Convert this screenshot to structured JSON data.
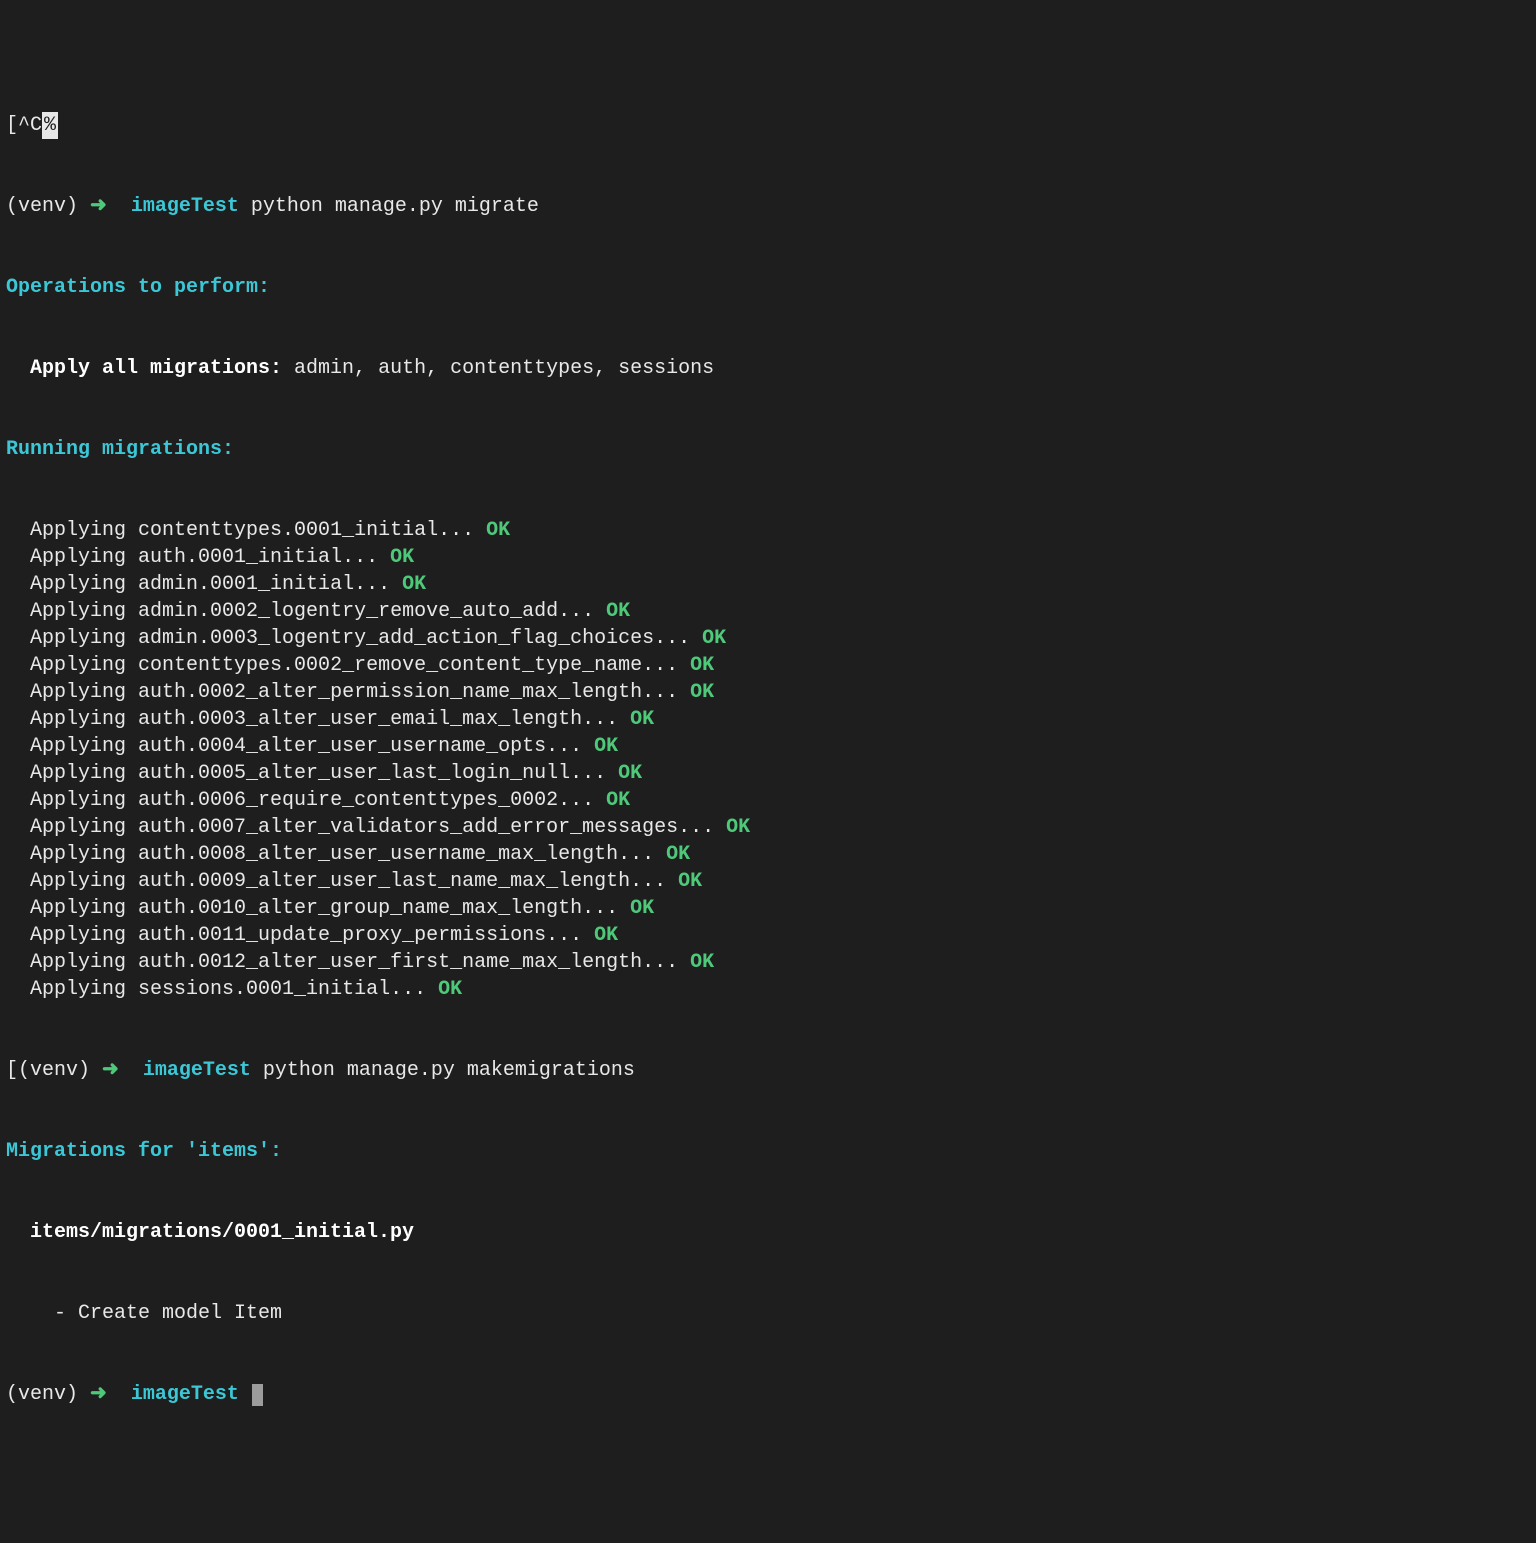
{
  "top_line": {
    "pre": "[^C",
    "pct": "%"
  },
  "prompt": {
    "venv": "(venv)",
    "arrow": "➜",
    "dir": "imageTest"
  },
  "cmd_migrate": "python manage.py migrate",
  "cmd_makemig": "python manage.py makemigrations",
  "headers": {
    "ops": "Operations to perform:",
    "apply_all": "Apply all migrations:",
    "apply_all_tail": " admin, auth, contenttypes, sessions",
    "running": "Running migrations:",
    "mig_for": "Migrations for 'items':",
    "mig_file": "items/migrations/0001_initial.py",
    "create_model": "- Create model Item"
  },
  "ok_label": "OK",
  "apply_prefix": "Applying ",
  "dots": "... ",
  "migrations": [
    "contenttypes.0001_initial",
    "auth.0001_initial",
    "admin.0001_initial",
    "admin.0002_logentry_remove_auto_add",
    "admin.0003_logentry_add_action_flag_choices",
    "contenttypes.0002_remove_content_type_name",
    "auth.0002_alter_permission_name_max_length",
    "auth.0003_alter_user_email_max_length",
    "auth.0004_alter_user_username_opts",
    "auth.0005_alter_user_last_login_null",
    "auth.0006_require_contenttypes_0002",
    "auth.0007_alter_validators_add_error_messages",
    "auth.0008_alter_user_username_max_length",
    "auth.0009_alter_user_last_name_max_length",
    "auth.0010_alter_group_name_max_length",
    "auth.0011_update_proxy_permissions",
    "auth.0012_alter_user_first_name_max_length",
    "sessions.0001_initial"
  ]
}
